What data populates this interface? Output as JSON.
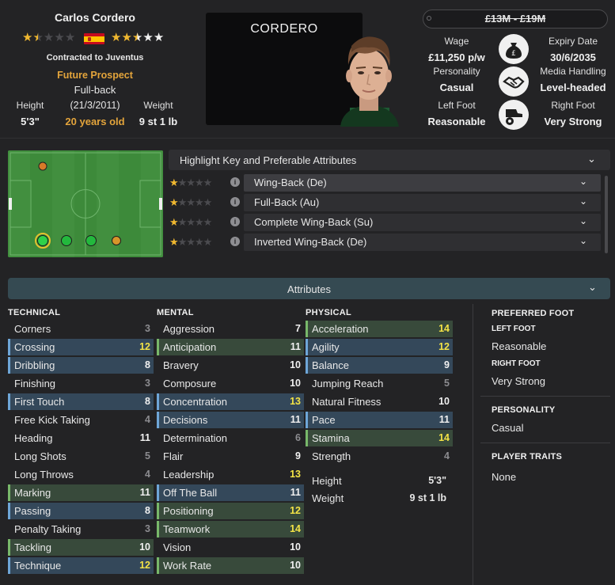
{
  "player": {
    "name": "Carlos Cordero",
    "short_name": "CORDERO",
    "contract": "Contracted to Juventus",
    "status": "Future Prospect",
    "position": "Full-back",
    "height_label": "Height",
    "height": "5'3\"",
    "dob": "(21/3/2011)",
    "age": "20 years old",
    "weight_label": "Weight",
    "weight": "9 st 1 lb",
    "current_ability_stars": 1.5,
    "potential_ability_stars": 2.5,
    "nationality_flag": "spain-flag"
  },
  "finance": {
    "value_range": "£13M - £19M",
    "wage_label": "Wage",
    "wage": "£11,250 p/w",
    "expiry_label": "Expiry Date",
    "expiry": "30/6/2035",
    "personality_label": "Personality",
    "personality": "Casual",
    "media_label": "Media Handling",
    "media": "Level-headed",
    "left_foot_label": "Left Foot",
    "left_foot": "Reasonable",
    "right_foot_label": "Right Foot",
    "right_foot": "Very Strong"
  },
  "roles": {
    "header": "Highlight Key and Preferable Attributes",
    "items": [
      {
        "label": "Wing-Back (De)",
        "stars": 1
      },
      {
        "label": "Full-Back (Au)",
        "stars": 1
      },
      {
        "label": "Complete Wing-Back (Su)",
        "stars": 1
      },
      {
        "label": "Inverted Wing-Back (De)",
        "stars": 1
      }
    ]
  },
  "attributes_bar": "Attributes",
  "technical": {
    "title": "TECHNICAL",
    "items": [
      {
        "name": "Corners",
        "value": "3",
        "hl": ""
      },
      {
        "name": "Crossing",
        "value": "12",
        "hl": "blue"
      },
      {
        "name": "Dribbling",
        "value": "8",
        "hl": "blue"
      },
      {
        "name": "Finishing",
        "value": "3",
        "hl": ""
      },
      {
        "name": "First Touch",
        "value": "8",
        "hl": "blue"
      },
      {
        "name": "Free Kick Taking",
        "value": "4",
        "hl": ""
      },
      {
        "name": "Heading",
        "value": "11",
        "hl": ""
      },
      {
        "name": "Long Shots",
        "value": "5",
        "hl": ""
      },
      {
        "name": "Long Throws",
        "value": "4",
        "hl": ""
      },
      {
        "name": "Marking",
        "value": "11",
        "hl": "green"
      },
      {
        "name": "Passing",
        "value": "8",
        "hl": "blue"
      },
      {
        "name": "Penalty Taking",
        "value": "3",
        "hl": ""
      },
      {
        "name": "Tackling",
        "value": "10",
        "hl": "green"
      },
      {
        "name": "Technique",
        "value": "12",
        "hl": "blue"
      }
    ]
  },
  "mental": {
    "title": "MENTAL",
    "items": [
      {
        "name": "Aggression",
        "value": "7",
        "hl": ""
      },
      {
        "name": "Anticipation",
        "value": "11",
        "hl": "green"
      },
      {
        "name": "Bravery",
        "value": "10",
        "hl": ""
      },
      {
        "name": "Composure",
        "value": "10",
        "hl": ""
      },
      {
        "name": "Concentration",
        "value": "13",
        "hl": "blue"
      },
      {
        "name": "Decisions",
        "value": "11",
        "hl": "blue"
      },
      {
        "name": "Determination",
        "value": "6",
        "hl": ""
      },
      {
        "name": "Flair",
        "value": "9",
        "hl": ""
      },
      {
        "name": "Leadership",
        "value": "13",
        "hl": ""
      },
      {
        "name": "Off The Ball",
        "value": "11",
        "hl": "blue"
      },
      {
        "name": "Positioning",
        "value": "12",
        "hl": "green"
      },
      {
        "name": "Teamwork",
        "value": "14",
        "hl": "green"
      },
      {
        "name": "Vision",
        "value": "10",
        "hl": ""
      },
      {
        "name": "Work Rate",
        "value": "10",
        "hl": "green"
      }
    ]
  },
  "physical": {
    "title": "PHYSICAL",
    "items": [
      {
        "name": "Acceleration",
        "value": "14",
        "hl": "green"
      },
      {
        "name": "Agility",
        "value": "12",
        "hl": "blue"
      },
      {
        "name": "Balance",
        "value": "9",
        "hl": "blue"
      },
      {
        "name": "Jumping Reach",
        "value": "5",
        "hl": ""
      },
      {
        "name": "Natural Fitness",
        "value": "10",
        "hl": ""
      },
      {
        "name": "Pace",
        "value": "11",
        "hl": "blue"
      },
      {
        "name": "Stamina",
        "value": "14",
        "hl": "green"
      },
      {
        "name": "Strength",
        "value": "4",
        "hl": ""
      }
    ],
    "height_label": "Height",
    "height": "5'3\"",
    "weight_label": "Weight",
    "weight": "9 st 1 lb"
  },
  "side": {
    "preferred_foot_title": "PREFERRED FOOT",
    "left_foot_label": "LEFT FOOT",
    "left_foot": "Reasonable",
    "right_foot_label": "RIGHT FOOT",
    "right_foot": "Very Strong",
    "personality_title": "PERSONALITY",
    "personality": "Casual",
    "traits_title": "PLAYER TRAITS",
    "traits": "None"
  },
  "colors": {
    "accent_orange": "#e3a43b",
    "highlight_blue": "#6ea6d8",
    "highlight_green": "#78b86a",
    "value_high": "#f3e346",
    "star_gold": "#f0b830"
  }
}
